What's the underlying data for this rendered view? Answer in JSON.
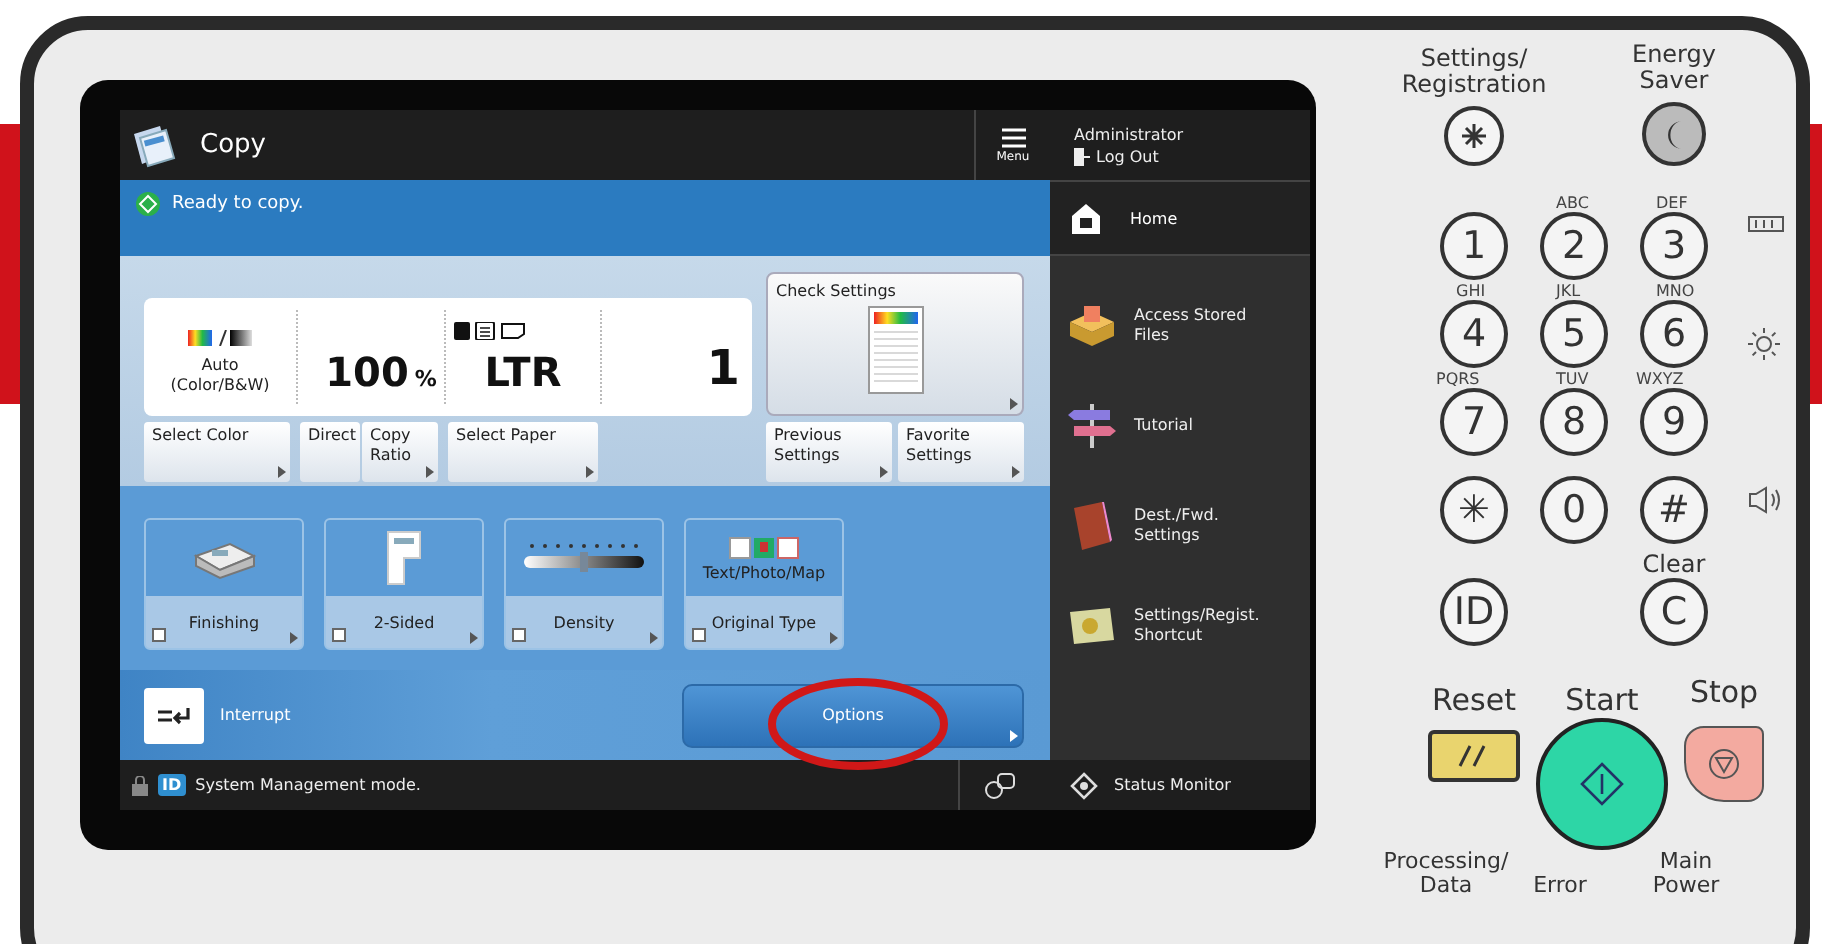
{
  "screen": {
    "header": {
      "title": "Copy",
      "menu_label": "Menu"
    },
    "status": {
      "message": "Ready to copy."
    },
    "summary": {
      "color_mode": "Auto (Color/B&W)",
      "ratio": "100",
      "ratio_unit": "%",
      "paper": "LTR",
      "copies": "1"
    },
    "check_settings": "Check Settings",
    "left_buttons": [
      {
        "label": "Select Color",
        "arrow": true
      },
      {
        "label": "Direct",
        "arrow": false
      },
      {
        "label": "Copy Ratio",
        "arrow": true
      },
      {
        "label": "Select Paper",
        "arrow": true
      }
    ],
    "right_buttons": [
      {
        "label": "Previous Settings"
      },
      {
        "label": "Favorite Settings"
      }
    ],
    "functions": [
      {
        "label": "Finishing",
        "kind": "finishing"
      },
      {
        "label": "2-Sided",
        "kind": "two_sided"
      },
      {
        "label": "Density",
        "kind": "density"
      },
      {
        "label": "Original Type",
        "kind": "original_type",
        "caption": "Text/Photo/Map"
      }
    ],
    "interrupt": "Interrupt",
    "options": "Options",
    "footer": {
      "id_badge": "ID",
      "message": "System Management mode."
    }
  },
  "sidebar": {
    "user": "Administrator",
    "logout": "Log Out",
    "home": "Home",
    "items": [
      {
        "label": "Access Stored Files",
        "kind": "box"
      },
      {
        "label": "Tutorial",
        "kind": "signpost"
      },
      {
        "label": "Dest./Fwd. Settings",
        "kind": "book"
      },
      {
        "label": "Settings/Regist. Shortcut",
        "kind": "card"
      }
    ],
    "status_monitor": "Status Monitor"
  },
  "keypad": {
    "top": [
      {
        "label": "Settings/ Registration",
        "kind": "settings"
      },
      {
        "label": "Energy Saver",
        "kind": "energy"
      }
    ],
    "key_rows": [
      [
        {
          "digit": "1"
        },
        {
          "digit": "2",
          "letters": "ABC"
        },
        {
          "digit": "3",
          "letters": "DEF"
        }
      ],
      [
        {
          "digit": "4",
          "letters": "GHI"
        },
        {
          "digit": "5",
          "letters": "JKL"
        },
        {
          "digit": "6",
          "letters": "MNO"
        }
      ],
      [
        {
          "digit": "7",
          "letters": "PQRS"
        },
        {
          "digit": "8",
          "letters": "TUV"
        },
        {
          "digit": "9",
          "letters": "WXYZ"
        }
      ],
      [
        {
          "digit": "✳"
        },
        {
          "digit": "0"
        },
        {
          "digit": "#"
        }
      ]
    ],
    "id_key": "ID",
    "clear_label": "Clear",
    "clear_key": "C",
    "reset": "Reset",
    "start": "Start",
    "stop": "Stop",
    "indicators": [
      "Processing/ Data",
      "Error",
      "Main Power"
    ]
  }
}
